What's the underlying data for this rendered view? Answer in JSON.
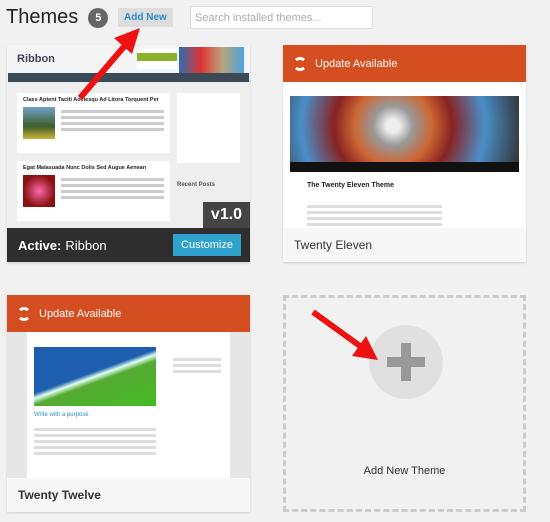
{
  "header": {
    "title": "Themes",
    "count": "5",
    "add_new": "Add New",
    "search_placeholder": "Search installed themes..."
  },
  "themes": [
    {
      "name": "Ribbon",
      "active_label": "Active:",
      "customize": "Customize",
      "version": "v1.0",
      "logo": "Ribbon",
      "preview_posts": [
        "Class Aptent Taciti Aociesqu Ad Litora Torquent Per",
        "Egat Malasuada Nunc Dolis Sed Augue Aenean"
      ],
      "preview_sidebar": "Recent Posts"
    },
    {
      "name": "Twenty Eleven",
      "update": "Update Available",
      "preview_title": "The Twenty Eleven Theme"
    },
    {
      "name": "Twenty Twelve",
      "update": "Update Available",
      "preview_title": "Write with a purpose"
    }
  ],
  "add_theme": {
    "label": "Add New Theme"
  },
  "colors": {
    "update": "#d54e21",
    "primary": "#2ea2cc",
    "arrow": "#ee1111"
  }
}
